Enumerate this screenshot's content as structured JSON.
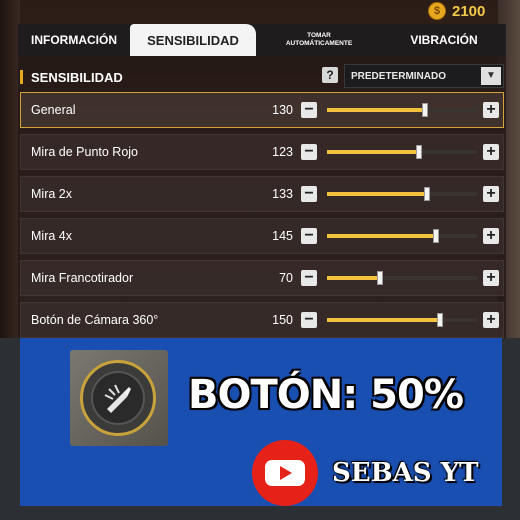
{
  "header": {
    "coins": "2100",
    "coin_icon": "coin-icon"
  },
  "tabs": [
    {
      "label": "INFORMACIÓN",
      "active": false
    },
    {
      "label": "SENSIBILIDAD",
      "active": true
    },
    {
      "label": "TOMAR AUTOMÁTICAMENTE",
      "active": false
    },
    {
      "label": "VIBRACIÓN",
      "active": false
    }
  ],
  "section": {
    "title": "SENSIBILIDAD",
    "help": "?",
    "preset": "PREDETERMINADO"
  },
  "controls": {
    "minus": "−",
    "plus": "+"
  },
  "max_value": 200,
  "rows": [
    {
      "label": "General",
      "value": 130
    },
    {
      "label": "Mira de Punto Rojo",
      "value": 123
    },
    {
      "label": "Mira 2x",
      "value": 133
    },
    {
      "label": "Mira 4x",
      "value": 145
    },
    {
      "label": "Mira Francotirador",
      "value": 70
    },
    {
      "label": "Botón de Cámara 360°",
      "value": 150
    }
  ],
  "overlay": {
    "boton": "BOTÓN: 50%",
    "channel": "SEBAS YT"
  },
  "colors": {
    "accent": "#f2c23c",
    "banner": "#1a4fb2",
    "youtube": "#e62117"
  }
}
